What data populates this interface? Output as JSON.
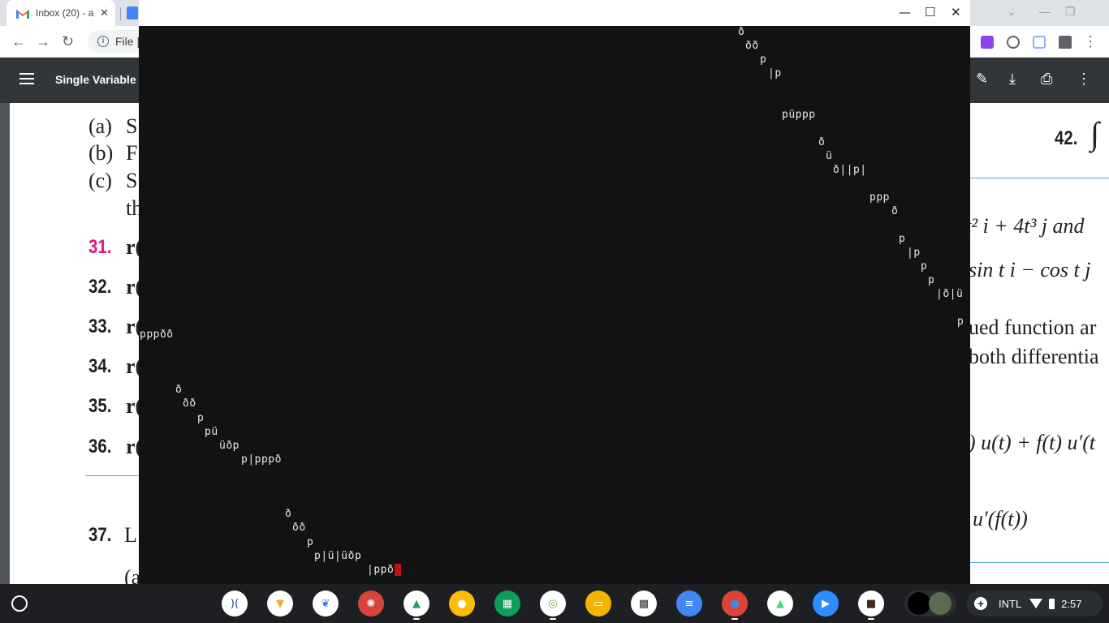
{
  "browser": {
    "tab_title": "Inbox (20) - a",
    "tab_close": "✕",
    "omnibox_text": "File |",
    "min_glyph": "—",
    "max_glyph": "❐",
    "tab_dropdown": "⌄",
    "info_glyph": "i"
  },
  "pdf_viewer": {
    "doc_title": "Single Variable C",
    "actions": {
      "edit": "✎",
      "download": "⤓",
      "print": "⎙",
      "more": "⋮"
    }
  },
  "pdf_page": {
    "left": {
      "parts": [
        "(a)",
        "S",
        "(b)",
        "F",
        "(c)",
        "S",
        "th"
      ],
      "problems": [
        {
          "num": "31.",
          "text": "r("
        },
        {
          "num": "32.",
          "text": "r("
        },
        {
          "num": "33.",
          "text": "r("
        },
        {
          "num": "34.",
          "text": "r("
        },
        {
          "num": "35.",
          "text": "r("
        },
        {
          "num": "36.",
          "text": "r("
        },
        {
          "num": "37.",
          "text": "L"
        }
      ],
      "bottom_frag": "(a"
    },
    "right": {
      "problem42": "42.",
      "integral": "∫",
      "line1": "t² i + 4t³ j and",
      "line2": "sin t i − cos t j",
      "line3": "ued function ar",
      "line4": "both differentia",
      "line5": ") u(t) + f(t) u′(t",
      "line6": "u′(f(t))"
    }
  },
  "terminal": {
    "window_controls": {
      "minimize": "—",
      "maximize": "☐",
      "close": "✕"
    },
    "lines": [
      "ð",
      "ðð",
      "p",
      "|p",
      "püppp",
      "ð",
      "ü",
      "ð||p|",
      "ppp",
      "ð",
      "p",
      "|p",
      "p",
      "p",
      "|ð|ü",
      "p",
      "pppðð",
      "ð",
      "ðð",
      "p",
      "pü",
      "üðp",
      "p|pppð",
      "ð",
      "ðð",
      "p",
      "p|ü|üðp",
      "|ppð"
    ]
  },
  "shelf": {
    "launcher_icon": "launcher-icon",
    "apps": [
      {
        "name": "mindomo-app-icon",
        "color": "#ffffff",
        "glyph": ")(",
        "glyph_color": "#1c3c78"
      },
      {
        "name": "vpn-app-icon",
        "color": "#ffffff",
        "glyph": "▼",
        "glyph_color": "#f2a93b"
      },
      {
        "name": "butterfly-app-icon",
        "color": "#ffffff",
        "glyph": "❦",
        "glyph_color": "#3b78e7"
      },
      {
        "name": "perplexity-app-icon",
        "color": "#d6453d",
        "glyph": "✺",
        "glyph_color": "#ffffff"
      },
      {
        "name": "google-drive-icon",
        "color": "#ffffff",
        "glyph": "▲",
        "glyph_color": "#1fa463"
      },
      {
        "name": "google-keep-icon",
        "color": "#fbbc04",
        "glyph": "●",
        "glyph_color": "#ffffff"
      },
      {
        "name": "google-sheets-icon",
        "color": "#0f9d58",
        "glyph": "▦",
        "glyph_color": "#ffffff"
      },
      {
        "name": "screencast-app-icon",
        "color": "#ffffff",
        "glyph": "◎",
        "glyph_color": "#7cb342"
      },
      {
        "name": "google-slides-icon",
        "color": "#f4b400",
        "glyph": "▭",
        "glyph_color": "#ffffff"
      },
      {
        "name": "qr-app-icon",
        "color": "#ffffff",
        "glyph": "▩",
        "glyph_color": "#333333"
      },
      {
        "name": "google-docs-icon",
        "color": "#4285f4",
        "glyph": "≡",
        "glyph_color": "#ffffff"
      },
      {
        "name": "chrome-icon",
        "color": "#db4437",
        "glyph": "●",
        "glyph_color": "#4285f4"
      },
      {
        "name": "android-app-icon",
        "color": "#ffffff",
        "glyph": "▲",
        "glyph_color": "#3ddc84"
      },
      {
        "name": "zoom-app-icon",
        "color": "#2d8cff",
        "glyph": "▶",
        "glyph_color": "#ffffff"
      },
      {
        "name": "screen-recorder-icon",
        "color": "#ffffff",
        "glyph": "■",
        "glyph_color": "#3c2a20"
      }
    ],
    "tray": {
      "plus": "+",
      "ime": "INTL",
      "time": "2:57"
    }
  }
}
